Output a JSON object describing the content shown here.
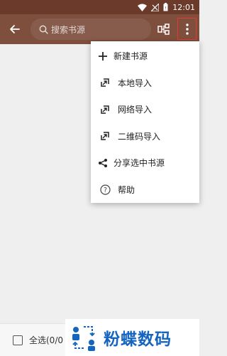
{
  "status_bar": {
    "time": "12:01"
  },
  "toolbar": {
    "search_placeholder": "搜索书源"
  },
  "menu": {
    "items": [
      {
        "label": "新建书源",
        "icon": "plus-icon"
      },
      {
        "label": "本地导入",
        "icon": "import-icon"
      },
      {
        "label": "网络导入",
        "icon": "import-icon"
      },
      {
        "label": "二维码导入",
        "icon": "import-icon"
      },
      {
        "label": "分享选中书源",
        "icon": "share-icon"
      },
      {
        "label": "帮助",
        "icon": "help-icon"
      }
    ]
  },
  "bottom_bar": {
    "select_all_label": "全选(0/0"
  },
  "watermark": {
    "text": "粉蝶数码"
  },
  "colors": {
    "toolbar": "#7e4f3d",
    "status_bar": "#6b3a2a",
    "highlight": "#e53935",
    "watermark": "#1565c0"
  }
}
